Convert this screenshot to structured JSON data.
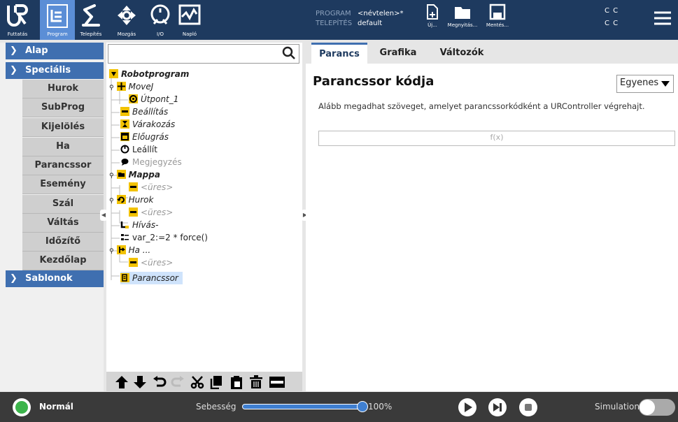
{
  "topbar": {
    "buttons": [
      {
        "label": "Futtatás",
        "icon": "ur-logo-icon"
      },
      {
        "label": "Program",
        "icon": "program-icon"
      },
      {
        "label": "Telepítés",
        "icon": "robot-arm-icon"
      },
      {
        "label": "Mozgás",
        "icon": "move-arrows-icon"
      },
      {
        "label": "I/O",
        "icon": "io-icon"
      },
      {
        "label": "Napló",
        "icon": "log-icon"
      }
    ],
    "program_label": "PROGRAM",
    "program_value": "<névtelen>*",
    "installation_label": "TELEPÍTÉS",
    "installation_value": "default",
    "file_buttons": [
      {
        "label": "Új...",
        "icon": "new-file-icon"
      },
      {
        "label": "Megnyitás...",
        "icon": "open-folder-icon"
      },
      {
        "label": "Mentés...",
        "icon": "save-icon"
      }
    ],
    "cc_top": "C C",
    "cc_bottom": "C C"
  },
  "leftnav": {
    "alap": "Alap",
    "specialis": "Speciális",
    "items": [
      "Hurok",
      "SubProg",
      "Kijelölés",
      "Ha",
      "Parancssor",
      "Esemény",
      "Szál",
      "Váltás",
      "Időzítő",
      "Kezdőlap"
    ],
    "sablonok": "Sablonok"
  },
  "tree": {
    "search_placeholder": "",
    "rows": [
      {
        "text": "Robotprogram",
        "style": "bold-it",
        "icon": "yellow-triangle-icon"
      },
      {
        "text": "MoveJ",
        "style": "it",
        "icon": "movej-icon"
      },
      {
        "text": "Útpont_1",
        "style": "it",
        "icon": "waypoint-icon"
      },
      {
        "text": "Beállítás",
        "style": "it",
        "icon": "set-icon"
      },
      {
        "text": "Várakozás",
        "style": "it",
        "icon": "hourglass-icon"
      },
      {
        "text": "Előugrás",
        "style": "it",
        "icon": "popup-icon"
      },
      {
        "text": "Leállít",
        "style": "",
        "icon": "halt-icon"
      },
      {
        "text": "Megjegyzés",
        "style": "grey",
        "icon": "comment-icon"
      },
      {
        "text": "Mappa",
        "style": "bold-it",
        "icon": "folder-icon"
      },
      {
        "text": "<üres>",
        "style": "grey-it",
        "icon": "empty-icon"
      },
      {
        "text": "Hurok",
        "style": "it",
        "icon": "loop-icon"
      },
      {
        "text": "<üres>",
        "style": "grey-it",
        "icon": "empty-icon"
      },
      {
        "text": "Hívás-",
        "style": "it",
        "icon": "call-icon"
      },
      {
        "text": "var_2:=2 * force()",
        "style": "",
        "icon": "assignment-icon"
      },
      {
        "text": "Ha ...",
        "style": "it",
        "icon": "if-icon"
      },
      {
        "text": "<üres>",
        "style": "grey-it",
        "icon": "empty-icon"
      },
      {
        "text": "Parancssor",
        "style": "it",
        "icon": "script-icon"
      }
    ]
  },
  "right": {
    "tabs": [
      "Parancs",
      "Grafika",
      "Változók"
    ],
    "title": "Parancssor kódja",
    "dropdown": "Egyenes",
    "description": "Alább megadhat szöveget, amelyet parancssorkódként a URController végrehajt.",
    "expression": "f(x)"
  },
  "status": {
    "mode": "Normál",
    "speed_label": "Sebesség",
    "speed_value": "100%",
    "speed_fraction": 1.0,
    "simulation_label": "Simulation"
  }
}
